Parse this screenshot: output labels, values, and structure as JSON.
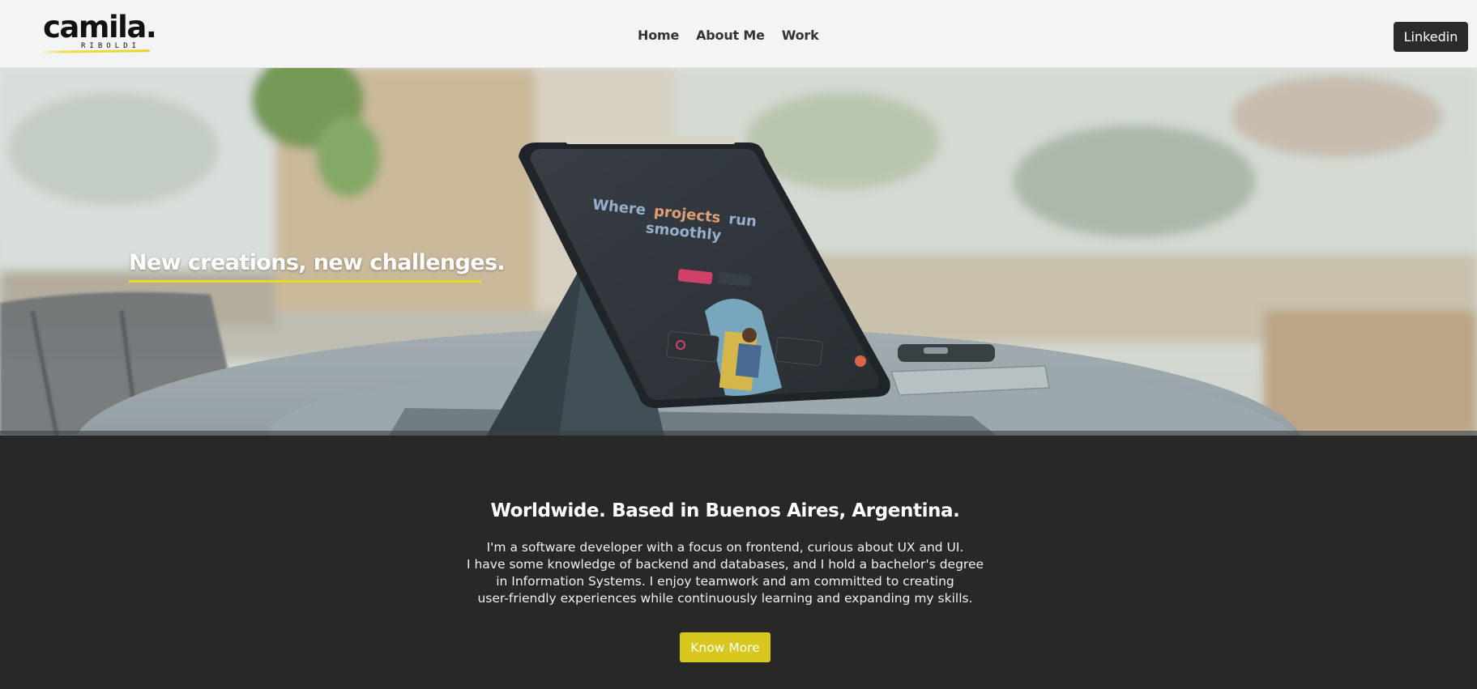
{
  "header": {
    "logo": {
      "main": "camila.",
      "sub": "RIBOLDI"
    },
    "nav": [
      {
        "label": "Home"
      },
      {
        "label": "About Me"
      },
      {
        "label": "Work"
      }
    ],
    "linkedin_label": "Linkedin"
  },
  "hero": {
    "headline": "New creations, new challenges.",
    "tablet_screen": {
      "line1_a": "Where",
      "line1_b": "projects",
      "line1_c": "run",
      "line2": "smoothly"
    }
  },
  "about": {
    "title": "Worldwide. Based in Buenos Aires, Argentina.",
    "lines": [
      "I'm a software developer with a focus on frontend, curious about UX and UI.",
      "I have some knowledge of backend and databases, and I hold a bachelor's degree",
      "in Information Systems. I enjoy teamwork and am committed to creating",
      "user-friendly experiences while continuously learning and expanding my skills."
    ],
    "button_label": "Know More"
  },
  "colors": {
    "accent_yellow": "#e8dc22",
    "dark_bg": "#282828",
    "nav_bg": "#f4f4f4",
    "button_yellow": "#d8c81e"
  }
}
